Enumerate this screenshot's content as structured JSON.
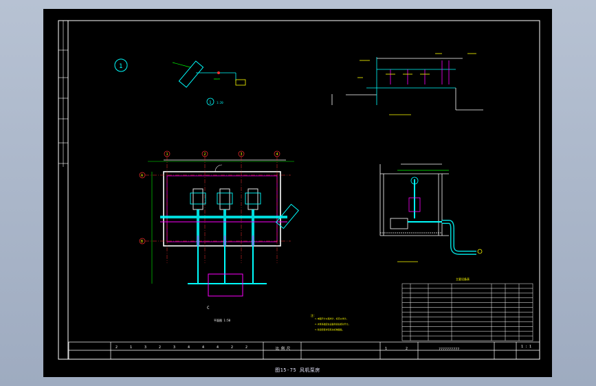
{
  "title_block": {
    "scale_text": "1 : 1",
    "drawing_name": "??????????",
    "row_digits": [
      "2",
      "1",
      "3",
      "2",
      "3",
      "4",
      "4",
      "4",
      "2",
      "2"
    ],
    "center_text": "比 例 尺",
    "page_marks": [
      "1",
      "2"
    ]
  },
  "caption": "图15-75 风机泵房",
  "plan": {
    "axis_top": [
      "1",
      "2",
      "3",
      "4"
    ],
    "axis_left": [
      "A",
      "B"
    ],
    "label": "C",
    "note": "平面图 1:50"
  },
  "detail": {
    "circle_label": "1",
    "ref_label": "1",
    "ref_scale": "1:20"
  },
  "notes": {
    "header": "注：",
    "lines": [
      "1.本图尺寸以毫米计，标高以米计。",
      "2.水泵基础应在设备到货后核对尺寸。",
      "3.管道安装详见有关标准图集。"
    ]
  },
  "legend": {
    "title": "主要设备表",
    "rows": 12,
    "columns": 6
  },
  "colors": {
    "line": "#ffffff",
    "cyan": "#00ffff",
    "yellow": "#ffff00",
    "magenta": "#ff00ff",
    "green": "#00ff00",
    "red": "#ff3030"
  }
}
